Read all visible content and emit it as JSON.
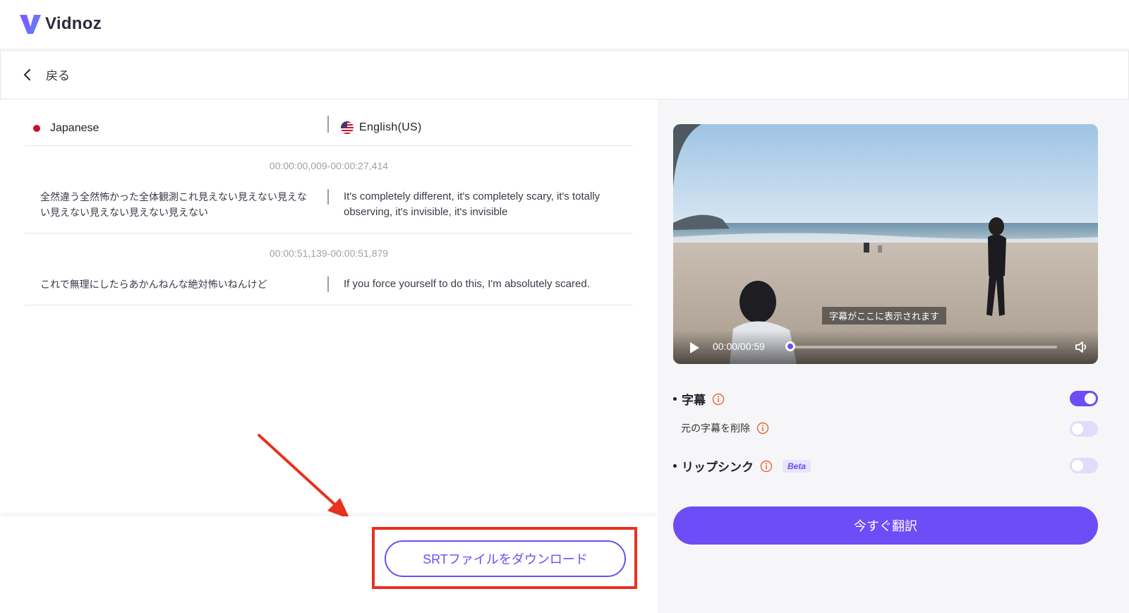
{
  "header": {
    "logo_text": "Vidnoz",
    "logo_icon": "vidnoz-logo-icon"
  },
  "nav": {
    "back_label": "戻る",
    "back_icon": "chevron-left-icon"
  },
  "languages": {
    "source": "Japanese",
    "target": "English(US)",
    "source_icon": "japan-dot-icon",
    "target_icon": "us-flag-icon"
  },
  "segments": [
    {
      "time": "00:00:00,009-00:00:27,414",
      "source": "全然違う全然怖かった全体観測これ見えない見えない見えない見えない見えない見えない見えない",
      "target": "It's completely different, it's completely scary, it's totally observing, it's invisible, it's invisible"
    },
    {
      "time": "00:00:51,139-00:00:51,879",
      "source": "これで無理にしたらあかんねんな絶対怖いねんけど",
      "target": "If you force yourself to do this, I'm absolutely scared."
    }
  ],
  "footer": {
    "srt_button": "SRTファイルをダウンロード"
  },
  "player": {
    "caption": "字幕がここに表示されます",
    "time": "00:00/00:59",
    "progress": 0.0
  },
  "options": {
    "subtitles_label": "字幕",
    "subtitles_on": true,
    "remove_original_label": "元の字幕を削除",
    "remove_original_on": false,
    "lipsync_label": "リップシンク",
    "lipsync_badge": "Beta",
    "lipsync_on": false
  },
  "actions": {
    "translate_now": "今すぐ翻訳"
  },
  "colors": {
    "accent": "#6c4df6",
    "highlight": "#e8321f",
    "info": "#e8632f"
  }
}
